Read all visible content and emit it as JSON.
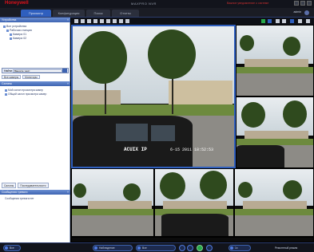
{
  "app": {
    "brand": "Honeywell",
    "product": "MAXPRO NVR",
    "notice": "Важное уведомление о системе",
    "user": "admin"
  },
  "tabs": [
    {
      "label": "Просмотр",
      "active": true
    },
    {
      "label": "Конфигурация",
      "active": false
    },
    {
      "label": "Поиск",
      "active": false
    },
    {
      "label": "Отчеты",
      "active": false
    }
  ],
  "sidebar": {
    "devices_panel": {
      "title": "Устройства",
      "tree": [
        "Все устройства",
        "Рабочая станция",
        "Камера 01",
        "Камера 02"
      ]
    },
    "search": {
      "label": "Найти",
      "value": "Введите текст",
      "placeholder": "Введите текст"
    },
    "subtabs": [
      "Все камеры",
      "Мониторы"
    ],
    "views_panel": {
      "title": "Салоны",
      "items": [
        "Мой салон просмотра камер",
        "Общий салон просмотра камер"
      ]
    },
    "bottom_buttons": [
      "Салоны",
      "Последовательности"
    ],
    "events_panel": {
      "title": "Сообщения тревоги",
      "items": [
        "Сообщения тревоги нет"
      ]
    }
  },
  "video": {
    "main_tile": {
      "camera_label": "ACUIX IP",
      "timestamp": "6-15 2011 18:52:53"
    },
    "small_tiles": [
      {
        "name": "cam-tile-top-right-1"
      },
      {
        "name": "cam-tile-top-right-2"
      },
      {
        "name": "cam-tile-bottom-1"
      },
      {
        "name": "cam-tile-bottom-2"
      },
      {
        "name": "cam-tile-bottom-3"
      },
      {
        "name": "cam-tile-bottom-4"
      }
    ]
  },
  "statusbar": {
    "items": [
      "Все",
      "Наблюдение",
      "Все"
    ],
    "zoom": "1x",
    "tail": "Ремонтный режим"
  },
  "colors": {
    "brand_red": "#e0121a",
    "accent_blue": "#2f5fbe",
    "panel_header": "#3d63b1"
  }
}
